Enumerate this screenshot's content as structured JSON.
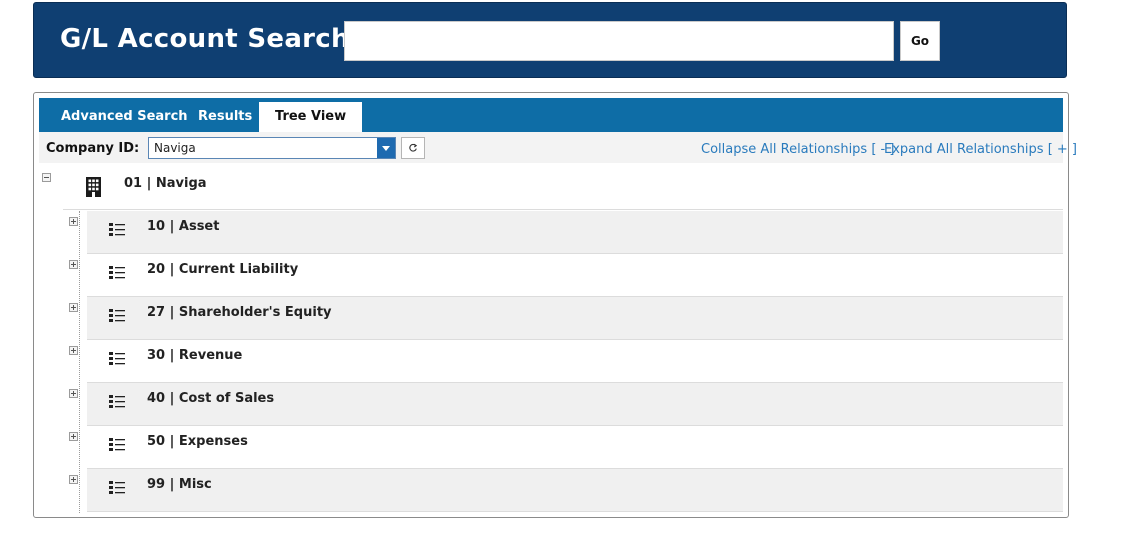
{
  "header": {
    "title": "G/L Account Search",
    "search_value": "",
    "go_label": "Go"
  },
  "tabs": [
    {
      "label": "Advanced Search",
      "active": false
    },
    {
      "label": "Results",
      "active": false
    },
    {
      "label": "Tree View",
      "active": true
    }
  ],
  "toolbar": {
    "company_label": "Company ID:",
    "company_selected": "Naviga",
    "collapse_all": "Collapse All Relationships [ - ]",
    "expand_all": "Expand All Relationships [ + ]"
  },
  "tree": {
    "root": {
      "label": "01 | Naviga",
      "icon": "building-icon",
      "expanded": true
    },
    "children": [
      {
        "label": "10 | Asset",
        "icon": "list-icon",
        "expanded": false
      },
      {
        "label": "20 | Current Liability",
        "icon": "list-icon",
        "expanded": false
      },
      {
        "label": "27 | Shareholder's Equity",
        "icon": "list-icon",
        "expanded": false
      },
      {
        "label": "30 | Revenue",
        "icon": "list-icon",
        "expanded": false
      },
      {
        "label": "40 | Cost of Sales",
        "icon": "list-icon",
        "expanded": false
      },
      {
        "label": "50 | Expenses",
        "icon": "list-icon",
        "expanded": false
      },
      {
        "label": "99 | Misc",
        "icon": "list-icon",
        "expanded": false
      }
    ]
  },
  "colors": {
    "header_bg": "#0f3f72",
    "tab_bar_bg": "#0e6da6",
    "link": "#2a7bbd",
    "alt_row": "#f0f0f0"
  }
}
